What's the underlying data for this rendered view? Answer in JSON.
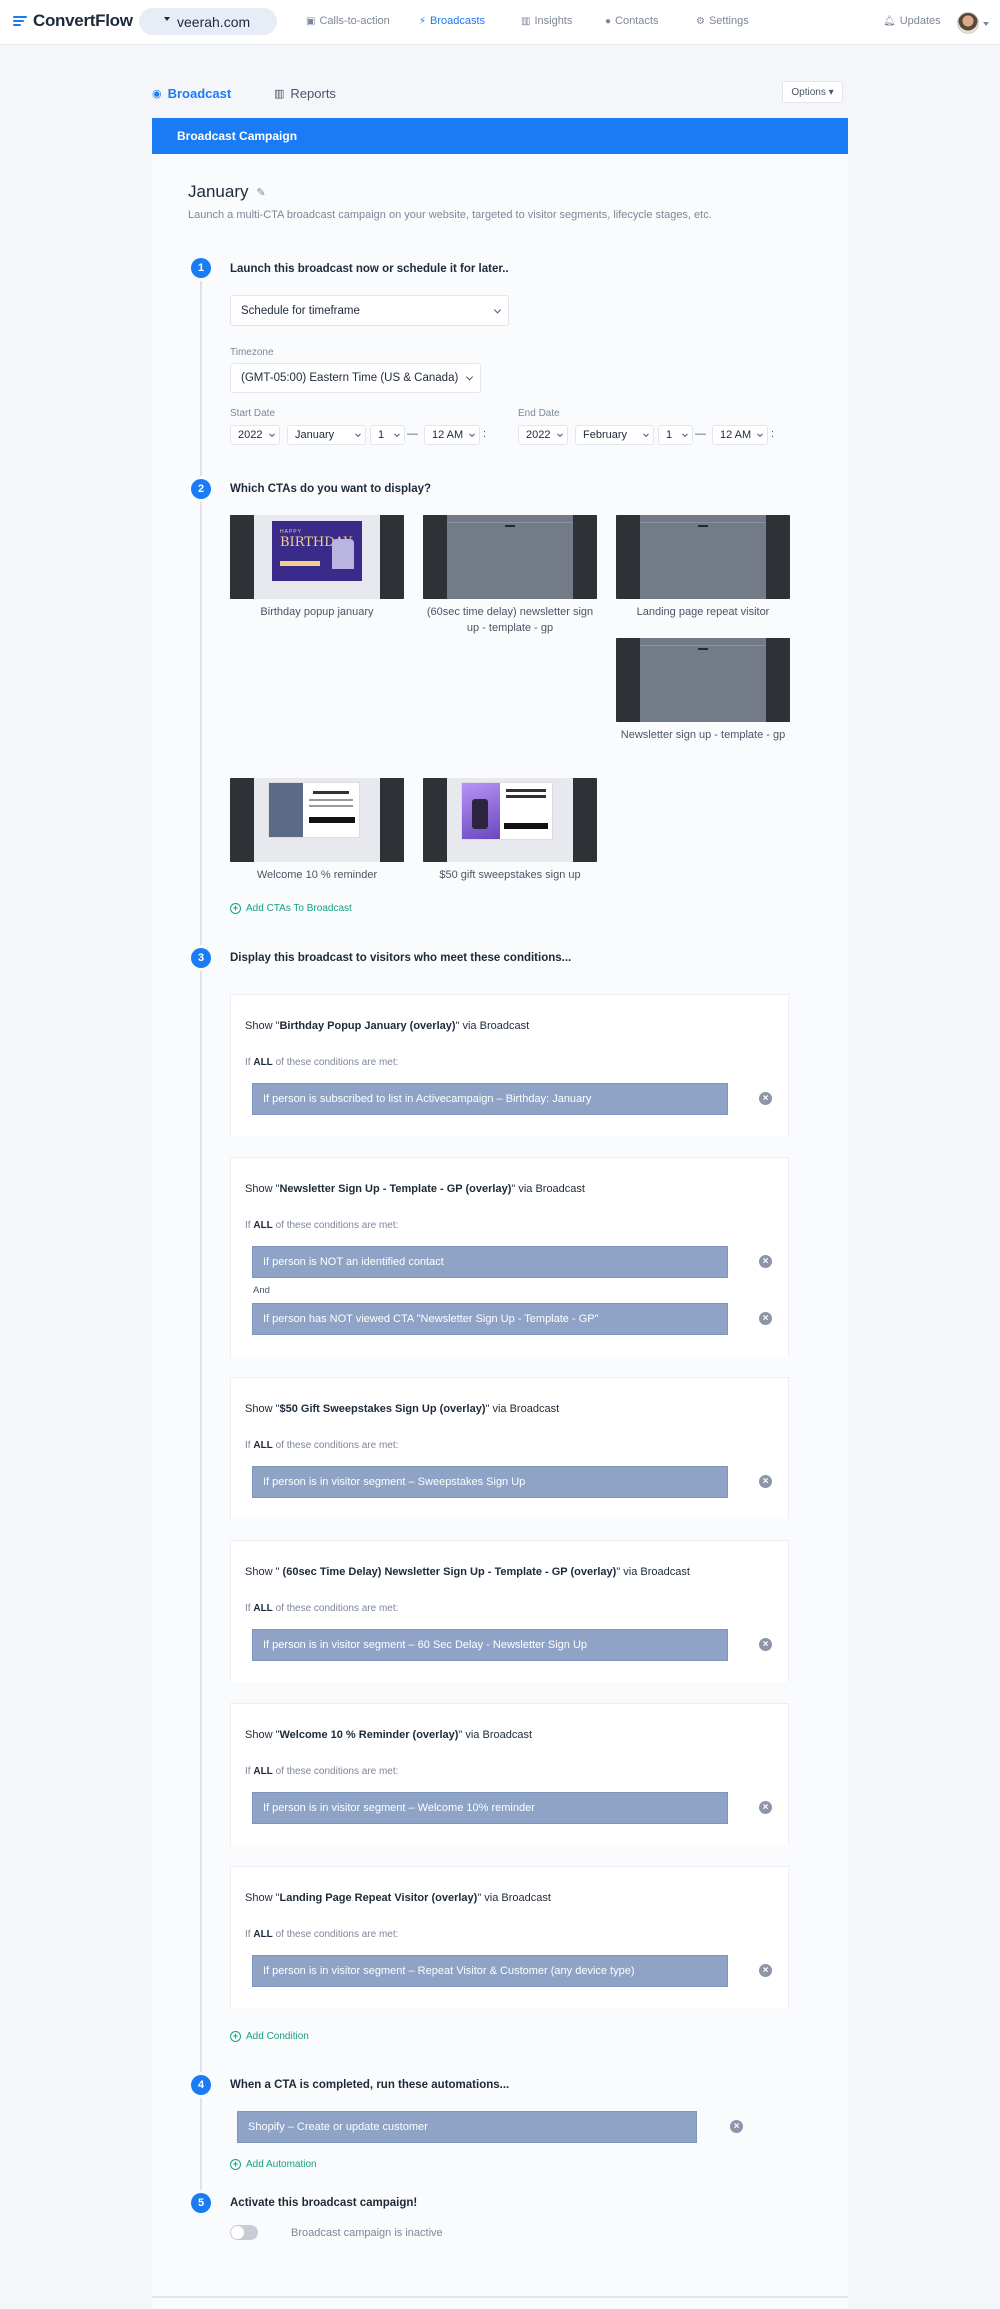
{
  "brand": {
    "name": "ConvertFlow",
    "accent": "#1a7cf5"
  },
  "site_selector": {
    "label": "veerah.com",
    "icon": "caret-down-icon"
  },
  "nav": [
    {
      "label": "Calls-to-action",
      "icon": "cta-icon"
    },
    {
      "label": "Broadcasts",
      "icon": "bolt-icon",
      "active": true
    },
    {
      "label": "Insights",
      "icon": "bar-chart-icon"
    },
    {
      "label": "Contacts",
      "icon": "person-icon"
    },
    {
      "label": "Settings",
      "icon": "gear-icon"
    },
    {
      "label": "Updates",
      "icon": "bell-icon"
    }
  ],
  "subtabs": {
    "broadcast": "Broadcast",
    "reports": "Reports",
    "options": "Options"
  },
  "card_header": "Broadcast Campaign",
  "campaign": {
    "name": "January",
    "description": "Launch a multi-CTA broadcast campaign on your website, targeted to visitor segments, lifecycle stages, etc."
  },
  "steps": [
    {
      "num": "1",
      "title": "Launch this broadcast now or schedule it for later.."
    },
    {
      "num": "2",
      "title": "Which CTAs do you want to display?"
    },
    {
      "num": "3",
      "title": "Display this broadcast to visitors who meet these conditions..."
    },
    {
      "num": "4",
      "title": "When a CTA is completed, run these automations..."
    },
    {
      "num": "5",
      "title": "Activate this broadcast campaign!"
    }
  ],
  "schedule": {
    "mode": "Schedule for timeframe",
    "timezone_label": "Timezone",
    "timezone": "(GMT-05:00) Eastern Time (US & Canada)",
    "start_label": "Start Date",
    "end_label": "End Date",
    "start": {
      "year": "2022",
      "month": "January",
      "day": "1",
      "time": "12 AM"
    },
    "end": {
      "year": "2022",
      "month": "February",
      "day": "1",
      "time": "12 AM"
    },
    "dash": "—",
    "colon": ":"
  },
  "ctas": [
    {
      "label": "Birthday popup january"
    },
    {
      "label": "(60sec time delay) newsletter sign up - template - gp"
    },
    {
      "label": "Landing page repeat visitor"
    },
    {
      "label": "Newsletter sign up - template - gp"
    },
    {
      "label": "Welcome 10 % reminder"
    },
    {
      "label": "$50 gift sweepstakes sign up"
    }
  ],
  "thumb_text": {
    "happy": "HAPPY",
    "birthday": "BIRTHDAY"
  },
  "add_ctas": "Add CTAs To Broadcast",
  "conditions": [
    {
      "show": "Show \"",
      "name": "Birthday Popup January (overlay)",
      "via": "\" via Broadcast",
      "if_pre": "If ",
      "if_all": "ALL",
      "if_post": " of these conditions are met:",
      "rules": [
        "If person is subscribed to list in Activecampaign – Birthday: January"
      ]
    },
    {
      "show": "Show \"",
      "name": "Newsletter Sign Up - Template - GP (overlay)",
      "via": "\" via Broadcast",
      "if_pre": "If ",
      "if_all": "ALL",
      "if_post": " of these conditions are met:",
      "rules": [
        "If person is NOT an identified contact",
        "If person has NOT viewed CTA \"Newsletter Sign Up - Template - GP\""
      ],
      "joiner": "And"
    },
    {
      "show": "Show \"",
      "name": "$50 Gift Sweepstakes Sign Up (overlay)",
      "via": "\" via Broadcast",
      "if_pre": "If ",
      "if_all": "ALL",
      "if_post": " of these conditions are met:",
      "rules": [
        "If person is in visitor segment – Sweepstakes Sign Up"
      ]
    },
    {
      "show": "Show \"",
      "name": " (60sec Time Delay) Newsletter Sign Up - Template - GP (overlay)",
      "via": "\" via Broadcast",
      "if_pre": "If ",
      "if_all": "ALL",
      "if_post": " of these conditions are met:",
      "rules": [
        "If person is in visitor segment – 60 Sec Delay - Newsletter Sign Up"
      ]
    },
    {
      "show": "Show \"",
      "name": "Welcome 10 % Reminder (overlay)",
      "via": "\" via Broadcast",
      "if_pre": "If ",
      "if_all": "ALL",
      "if_post": " of these conditions are met:",
      "rules": [
        "If person is in visitor segment – Welcome 10% reminder"
      ]
    },
    {
      "show": "Show \"",
      "name": "Landing Page Repeat Visitor (overlay)",
      "via": "\" via Broadcast",
      "if_pre": "If ",
      "if_all": "ALL",
      "if_post": " of these conditions are met:",
      "rules": [
        "If person is in visitor segment – Repeat Visitor & Customer (any device type)"
      ]
    }
  ],
  "add_condition": "Add Condition",
  "automation": {
    "rule": "Shopify – Create or update customer",
    "add": "Add Automation"
  },
  "activation": {
    "status": "Broadcast campaign is inactive",
    "active": false
  }
}
